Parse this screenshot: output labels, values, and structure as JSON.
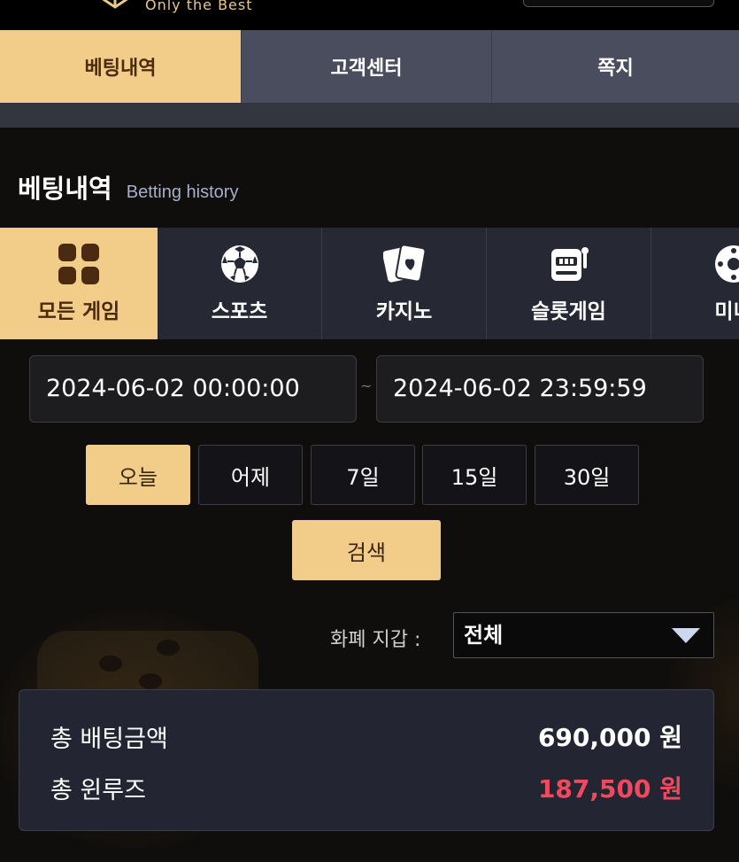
{
  "header": {
    "tagline": "Only the Best"
  },
  "nav": {
    "tabs": [
      {
        "label": "베팅내역",
        "active": true
      },
      {
        "label": "고객센터",
        "active": false
      },
      {
        "label": "쪽지",
        "active": false
      }
    ]
  },
  "section": {
    "title_ko": "베팅내역",
    "title_en": "Betting history"
  },
  "games": [
    {
      "label": "모든 게임",
      "icon": "grid-icon",
      "active": true
    },
    {
      "label": "스포츠",
      "icon": "soccer-ball-icon",
      "active": false
    },
    {
      "label": "카지노",
      "icon": "playing-cards-icon",
      "active": false
    },
    {
      "label": "슬롯게임",
      "icon": "slot-machine-icon",
      "active": false
    },
    {
      "label": "미니",
      "icon": "roulette-icon",
      "active": false
    }
  ],
  "filters": {
    "start_date": "2024-06-02 00:00:00",
    "end_date": "2024-06-02 23:59:59",
    "separator": "~",
    "ranges": [
      "오늘",
      "어제",
      "7일",
      "15일",
      "30일"
    ],
    "active_range": "오늘",
    "search_label": "검색",
    "currency_label": "화폐 지갑 :",
    "currency_value": "전체"
  },
  "summary": {
    "total_bet_label": "총 배팅금액",
    "total_bet_value": "690,000 원",
    "total_winloss_label": "총 윈루즈",
    "total_winloss_value": "187,500 원"
  },
  "colors": {
    "accent": "#f2cd8a",
    "tab_bg": "#4a4d5d",
    "panel_bg": "#232632",
    "loss_red": "#ee4a5f"
  }
}
